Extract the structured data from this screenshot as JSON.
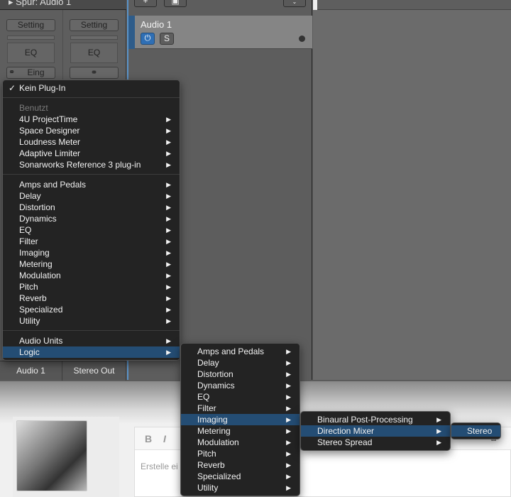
{
  "inspector": {
    "header": "Spur: Audio 1",
    "strips": [
      {
        "setting": "Setting",
        "eq": "EQ",
        "input": "Eing"
      },
      {
        "setting": "Setting",
        "eq": "EQ"
      }
    ],
    "tabs": [
      "Audio 1",
      "Stereo Out"
    ]
  },
  "track": {
    "name": "Audio 1",
    "solo": "S"
  },
  "menu1": {
    "selected": "Kein Plug-In",
    "used_header": "Benutzt",
    "used": [
      "4U ProjectTime",
      "Space Designer",
      "Loudness Meter",
      "Adaptive Limiter",
      "Sonarworks Reference 3 plug-in"
    ],
    "categories": [
      "Amps and Pedals",
      "Delay",
      "Distortion",
      "Dynamics",
      "EQ",
      "Filter",
      "Imaging",
      "Metering",
      "Modulation",
      "Pitch",
      "Reverb",
      "Specialized",
      "Utility"
    ],
    "bottom": [
      "Audio Units",
      "Logic"
    ]
  },
  "menu2": {
    "items": [
      "Amps and Pedals",
      "Delay",
      "Distortion",
      "Dynamics",
      "EQ",
      "Filter",
      "Imaging",
      "Metering",
      "Modulation",
      "Pitch",
      "Reverb",
      "Specialized",
      "Utility"
    ]
  },
  "menu3": {
    "items": [
      "Binaural Post-Processing",
      "Direction Mixer",
      "Stereo Spread"
    ]
  },
  "menu4": {
    "items": [
      "Stereo"
    ]
  },
  "editor": {
    "bold": "B",
    "italic": "I",
    "placeholder": "Erstelle ei"
  },
  "colors": {
    "highlight": "#244d74",
    "accent": "#2f6fb5"
  }
}
